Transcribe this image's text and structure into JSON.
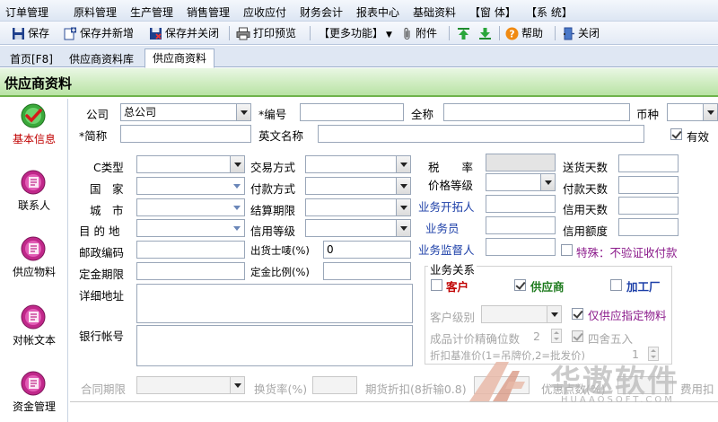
{
  "menu": [
    "订单管理",
    "原料管理",
    "生产管理",
    "销售管理",
    "应收应付",
    "财务会计",
    "报表中心",
    "基础资料",
    "【窗 体】",
    "【系 统】"
  ],
  "toolbar": {
    "save": "保存",
    "save_new": "保存并新增",
    "save_close": "保存并关闭",
    "print_preview": "打印预览",
    "more": "【更多功能】",
    "attach": "附件",
    "help": "帮助",
    "close": "关闭"
  },
  "tabs": [
    "首页[F8]",
    "供应商资料库",
    "供应商资料"
  ],
  "page_title": "供应商资料",
  "sidebar": [
    "基本信息",
    "联系人",
    "供应物料",
    "对帐文本",
    "资金管理"
  ],
  "form": {
    "company_label": "公司",
    "company_value": "总公司",
    "code_label": "*编号",
    "fullname_label": "全称",
    "currency_label": "币种",
    "short_label": "*简称",
    "english_label": "英文名称",
    "valid_label": "有效",
    "type_label": "C类型",
    "country_label": "国　家",
    "city_label": "城　市",
    "dest_label": "目 的 地",
    "zip_label": "邮政编码",
    "deposit_term_label": "定金期限",
    "address_label": "详细地址",
    "bank_label": "银行帐号",
    "trade_label": "交易方式",
    "pay_label": "付款方式",
    "settle_label": "结算期限",
    "credit_level_label": "信用等级",
    "ship_mark_label": "出货士唛(%)",
    "ship_mark_value": "0",
    "deposit_ratio_label": "定金比例(%)",
    "tax_label": "税　　率",
    "price_level_label": "价格等级",
    "biz_dev_label": "业务开拓人",
    "salesman_label": "业务员",
    "biz_sup_label": "业务监督人",
    "delivery_days_label": "送货天数",
    "pay_days_label": "付款天数",
    "credit_days_label": "信用天数",
    "credit_limit_label": "信用额度",
    "special_label": "特殊：不验证收付款",
    "relation_label": "业务关系",
    "customer_label": "客户",
    "supplier_label": "供应商",
    "factory_label": "加工厂",
    "cust_level_label": "客户级别",
    "only_material_label": "仅供应指定物料",
    "precision_label": "成品计价精确位数",
    "precision_value": "2",
    "round_label": "四舍五入",
    "discount_base_label": "折扣基准价(1=吊牌价,2=批发价)",
    "discount_base_value": "1",
    "contract_label": "合同期限",
    "exchange_label": "换货率(%)",
    "period_discount_label": "期货折扣(8折输0.8)",
    "favor_label": "优惠点数(%)",
    "fee_label": "费用扣"
  },
  "watermark": {
    "cn": "华遨软件",
    "en": "HUAAOSOFT.COM"
  },
  "colors": {
    "accent_green": "#6fb34c",
    "blue_label": "#1c3fa8",
    "purple_label": "#8b1a8b",
    "red_label": "#c00000"
  }
}
